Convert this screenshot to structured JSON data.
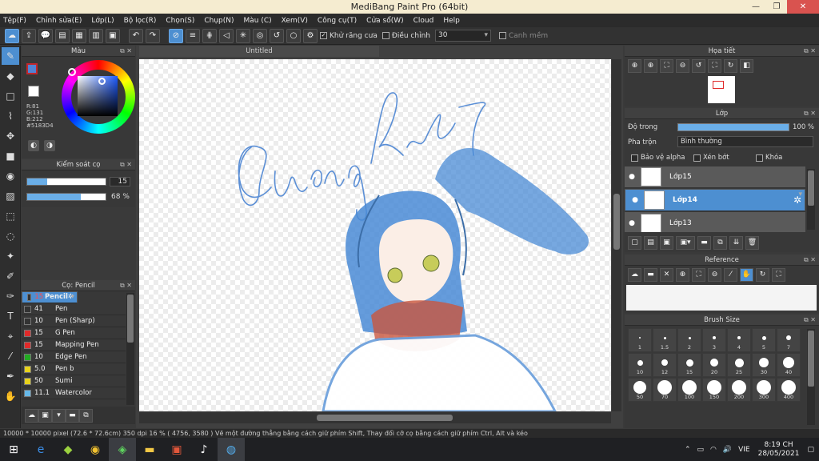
{
  "window": {
    "title": "MediBang Paint Pro (64bit)",
    "min": "—",
    "max": "❐",
    "close": "✕"
  },
  "menu": [
    "Tệp(F)",
    "Chỉnh sửa(E)",
    "Lớp(L)",
    "Bộ lọc(R)",
    "Chọn(S)",
    "Chụp(N)",
    "Màu (C)",
    "Xem(V)",
    "Công cụ(T)",
    "Cửa sổ(W)",
    "Cloud",
    "Help"
  ],
  "toolbar": {
    "antialias_label": "Khử răng cưa",
    "adjust_label": "Điều chỉnh",
    "adjust_value": "30",
    "margin_label": "Canh mềm"
  },
  "color_panel": {
    "title": "Màu",
    "r": "R:81",
    "g": "G:131",
    "b": "B:212",
    "hex": "#5183D4",
    "main_color": "#5183D4",
    "sub_color": "#c0272d"
  },
  "brush_control": {
    "title": "Kiểm soát cọ",
    "size_value": "15",
    "size_fill": 0.25,
    "opacity_value": "68 %",
    "opacity_fill": 0.68
  },
  "brush_panel": {
    "title": "Cọ: Pencil",
    "items": [
      {
        "size": "15",
        "name": "Pencil",
        "color": "#333333",
        "selected": true
      },
      {
        "size": "41",
        "name": "Pen",
        "color": "#333333"
      },
      {
        "size": "10",
        "name": "Pen (Sharp)",
        "color": "#333333"
      },
      {
        "size": "15",
        "name": "G Pen",
        "color": "#e02a2a"
      },
      {
        "size": "15",
        "name": "Mapping Pen",
        "color": "#e02a2a"
      },
      {
        "size": "10",
        "name": "Edge Pen",
        "color": "#22aa22"
      },
      {
        "size": "5.0",
        "name": "Pen b",
        "color": "#e8d21c"
      },
      {
        "size": "50",
        "name": "Sumi",
        "color": "#e8d21c"
      },
      {
        "size": "11.1",
        "name": "Watercolor",
        "color": "#66b8e8"
      }
    ]
  },
  "canvas": {
    "tab": "Untitled"
  },
  "navigator": {
    "title": "Họa tiết"
  },
  "layer_panel": {
    "title": "Lớp",
    "opacity_label": "Độ trong",
    "opacity_value": "100 %",
    "blend_label": "Pha trộn",
    "blend_value": "Bình thường",
    "protect_alpha": "Bảo vệ alpha",
    "clipping": "Xén bớt",
    "lock": "Khóa",
    "layers": [
      {
        "name": "Lớp15",
        "selected": false
      },
      {
        "name": "Lớp14",
        "selected": true
      },
      {
        "name": "Lớp13",
        "selected": false
      }
    ]
  },
  "reference": {
    "title": "Reference"
  },
  "brush_size": {
    "title": "Brush Size",
    "sizes": [
      "1",
      "1.5",
      "2",
      "3",
      "4",
      "5",
      "7",
      "10",
      "12",
      "15",
      "20",
      "25",
      "30",
      "40",
      "50",
      "70",
      "100",
      "150",
      "200",
      "300",
      "400"
    ]
  },
  "status": {
    "text": "10000 * 10000 pixel    (72.6 * 72.6cm)    350 dpi    16 %    ( 4756, 3580 )    Vẽ một đường thẳng bằng cách giữ phím Shift, Thay đổi cỡ cọ bằng cách giữ phím Ctrl, Alt và kéo"
  },
  "taskbar": {
    "lang": "VIE",
    "time": "8:19 CH",
    "date": "28/05/2021"
  }
}
